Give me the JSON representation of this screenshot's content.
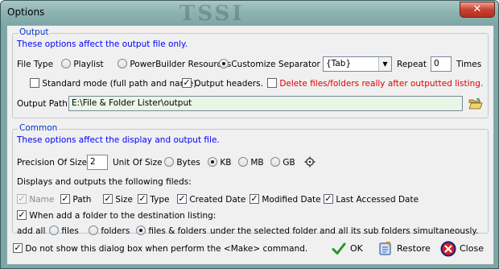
{
  "window": {
    "title": "Options",
    "watermark": "TSSI",
    "close_glyph": "✕"
  },
  "output": {
    "legend": "Output",
    "note": "These options affect the output file only.",
    "file_type_label": "File Type",
    "file_types": [
      "Playlist",
      "PowerBuilder Resources",
      "Customize"
    ],
    "file_type_selected": "Customize",
    "separator_label": "Separator",
    "separator_value": "{Tab}",
    "repeat_label": "Repeat",
    "repeat_value": "0",
    "times_label": "Times",
    "standard_mode_label": "Standard mode (full path and name).",
    "standard_mode_checked": false,
    "output_headers_label": "Output headers.",
    "output_headers_checked": true,
    "delete_label": "Delete files/folders really after outputted listing.",
    "delete_checked": false,
    "output_path_label": "Output Path",
    "output_path_value": "E:\\File & Folder Lister\\output",
    "browse_icon": "open-folder-icon"
  },
  "common": {
    "legend": "Common",
    "note": "These options affect the display and output file.",
    "precision_label": "Precision Of Size",
    "precision_value": "2",
    "unit_label": "Unit Of Size",
    "units": [
      "Bytes",
      "KB",
      "MB",
      "GB"
    ],
    "unit_selected": "KB",
    "unit_extra_icon": "gear-icon",
    "fields_heading": "Displays and outputs the following fileds:",
    "fields": [
      {
        "label": "Name",
        "checked": true,
        "disabled": true
      },
      {
        "label": "Path",
        "checked": true,
        "disabled": false
      },
      {
        "label": "Size",
        "checked": true,
        "disabled": false
      },
      {
        "label": "Type",
        "checked": true,
        "disabled": false
      },
      {
        "label": "Created Date",
        "checked": true,
        "disabled": false
      },
      {
        "label": "Modified Date",
        "checked": true,
        "disabled": false
      },
      {
        "label": "Last Accessed Date",
        "checked": true,
        "disabled": false
      }
    ],
    "when_add_label": "When add a folder to the destination listing:",
    "when_add_checked": true,
    "add_all_label": "add all",
    "add_modes": [
      "files",
      "folders",
      "files & folders"
    ],
    "add_mode_selected": "files & folders",
    "add_suffix": "under the selected folder and all its sub folders simultaneously."
  },
  "footer": {
    "dont_show_label": "Do not show this dialog box when perform the <Make> command.",
    "dont_show_checked": true,
    "ok_label": "OK",
    "restore_label": "Restore",
    "close_label": "Close"
  },
  "colors": {
    "accent_blue": "#0000ff",
    "warning_red": "#e00000",
    "legend_blue": "#0033cc",
    "path_bg": "#e9f5e5"
  }
}
